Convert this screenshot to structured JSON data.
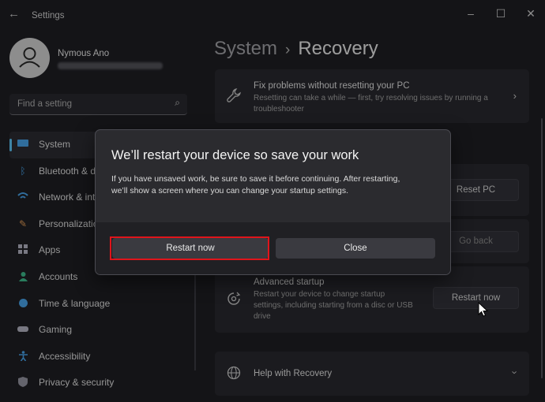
{
  "window": {
    "title": "Settings"
  },
  "profile": {
    "name": "Nymous Ano"
  },
  "search": {
    "placeholder": "Find a setting"
  },
  "sidebar": {
    "items": [
      {
        "label": "System",
        "icon": "display-icon",
        "color": "#4aa8f0"
      },
      {
        "label": "Bluetooth & devices",
        "icon": "bluetooth-icon",
        "color": "#4aa8f0"
      },
      {
        "label": "Network & internet",
        "icon": "wifi-icon",
        "color": "#4aa8f0"
      },
      {
        "label": "Personalization",
        "icon": "brush-icon",
        "color": "#e8a15a"
      },
      {
        "label": "Apps",
        "icon": "apps-icon",
        "color": "#b8b8c8"
      },
      {
        "label": "Accounts",
        "icon": "person-icon",
        "color": "#3fbf8f"
      },
      {
        "label": "Time & language",
        "icon": "globe-clock-icon",
        "color": "#4aa8f0"
      },
      {
        "label": "Gaming",
        "icon": "gamepad-icon",
        "color": "#b8b8c8"
      },
      {
        "label": "Accessibility",
        "icon": "accessibility-icon",
        "color": "#4aa8f0"
      },
      {
        "label": "Privacy & security",
        "icon": "shield-icon",
        "color": "#9a9aa6"
      }
    ]
  },
  "breadcrumb": {
    "parent": "System",
    "current": "Recovery"
  },
  "content": {
    "fix_problems": {
      "title": "Fix problems without resetting your PC",
      "desc_line1": "Resetting can take a while — first, try resolving issues by running a",
      "desc_line2": "troubleshooter"
    },
    "reset_button": "Reset PC",
    "go_back_button": "Go back",
    "advanced_startup": {
      "title": "Advanced startup",
      "desc_line1": "Restart your device to change startup",
      "desc_line2": "settings, including starting from a disc or USB",
      "desc_line3": "drive",
      "button": "Restart now"
    },
    "help": {
      "title": "Help with Recovery"
    }
  },
  "dialog": {
    "title": "We’ll restart your device so save your work",
    "body_line1": "If you have unsaved work, be sure to save it before continuing. After restarting,",
    "body_line2": "we’ll show a screen where you can change your startup settings.",
    "primary": "Restart now",
    "secondary": "Close"
  }
}
